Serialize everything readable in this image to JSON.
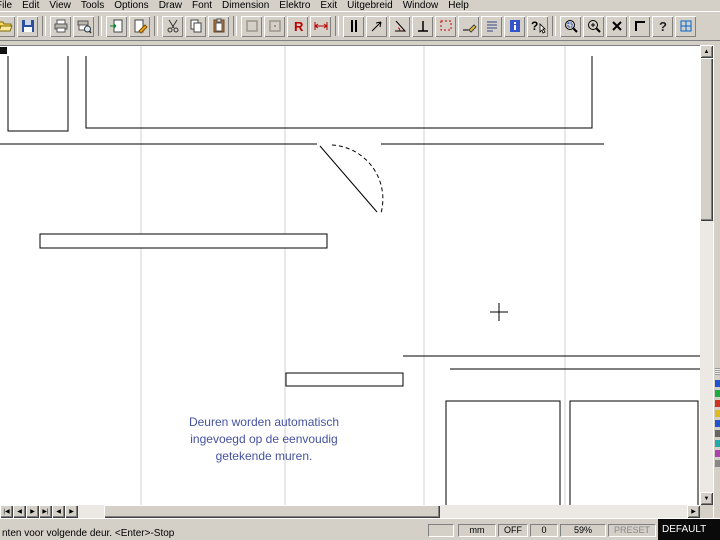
{
  "menu": {
    "items": [
      {
        "id": "file",
        "label": "File"
      },
      {
        "id": "edit",
        "label": "Edit"
      },
      {
        "id": "view",
        "label": "View"
      },
      {
        "id": "tools",
        "label": "Tools"
      },
      {
        "id": "options",
        "label": "Options"
      },
      {
        "id": "draw",
        "label": "Draw"
      },
      {
        "id": "font",
        "label": "Font"
      },
      {
        "id": "dimension",
        "label": "Dimension"
      },
      {
        "id": "elektro",
        "label": "Elektro"
      },
      {
        "id": "exit",
        "label": "Exit"
      },
      {
        "id": "uitgebreid",
        "label": "Uitgebreid"
      },
      {
        "id": "window",
        "label": "Window"
      },
      {
        "id": "help",
        "label": "Help"
      }
    ]
  },
  "toolbar": {
    "buttons": [
      "open",
      "save",
      "print",
      "print-preview",
      "import-page",
      "edit-page",
      "cut",
      "copy",
      "paste",
      "frame-a",
      "frame-b",
      "redline-symbol",
      "red-dimension",
      "parallel-lines",
      "snap-direction",
      "angle-snap",
      "perpendicular-snap",
      "selection-window",
      "draw-line",
      "line-list",
      "info",
      "context-help",
      "zoom-window",
      "zoom-scale",
      "erase",
      "corner-frame",
      "help",
      "grid-tool"
    ]
  },
  "canvas": {
    "annotation": {
      "lines": [
        "Deuren worden automatisch",
        "ingevoegd op de eenvoudig",
        "getekende muren."
      ],
      "color": "#4652a2"
    }
  },
  "scrollnav": [
    "|◀",
    "◀",
    "▶",
    "▶|",
    "◀",
    "▶"
  ],
  "scroll": {
    "up": "▲",
    "down": "▼",
    "left": "◀",
    "right": "▶"
  },
  "status": {
    "message": "nten voor volgende deur.   <Enter>-Stop",
    "spare": "",
    "units": "mm",
    "ortho": "OFF",
    "count": "0",
    "zoom": "59%",
    "preset": "PRESET FIT",
    "layer": "DEFAULT"
  },
  "colors": {
    "annotation_text": "#4652a2",
    "window_face": "#d4d0c8",
    "drawing_line": "#000000"
  }
}
